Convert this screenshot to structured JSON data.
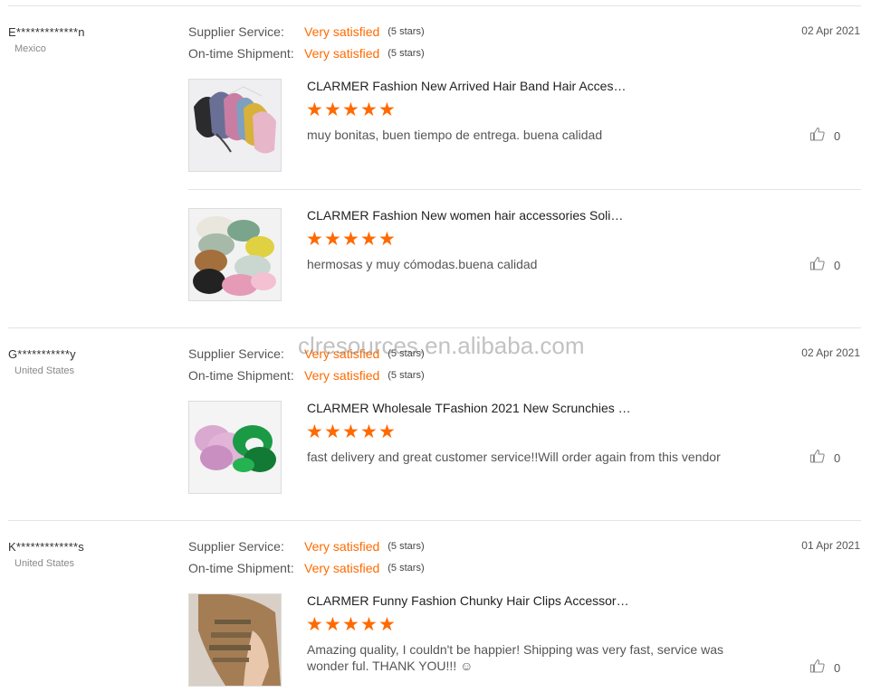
{
  "reviews": [
    {
      "name": "E*************n",
      "country": "Mexico",
      "date": "02 Apr 2021",
      "supplier_label": "Supplier Service:",
      "supplier_value": "Very satisfied",
      "supplier_stars": "(5 stars)",
      "shipment_label": "On-time Shipment:",
      "shipment_value": "Very satisfied",
      "shipment_stars": "(5 stars)",
      "products": [
        {
          "title": "CLARMER Fashion New Arrived Hair Band Hair Acces…",
          "rating": 5,
          "comment": "muy bonitas, buen tiempo de entrega. buena calidad",
          "likes": "0"
        },
        {
          "title": "CLARMER Fashion New women hair accessories Soli…",
          "rating": 5,
          "comment": "hermosas y muy cómodas.buena calidad",
          "likes": "0"
        }
      ]
    },
    {
      "name": "G***********y",
      "country": "United States",
      "date": "02 Apr 2021",
      "supplier_label": "Supplier Service:",
      "supplier_value": "Very satisfied",
      "supplier_stars": "(5 stars)",
      "shipment_label": "On-time Shipment:",
      "shipment_value": "Very satisfied",
      "shipment_stars": "(5 stars)",
      "products": [
        {
          "title": "CLARMER Wholesale TFashion 2021 New Scrunchies …",
          "rating": 5,
          "comment": "fast delivery and great customer service!!Will order again from this vendor",
          "likes": "0"
        }
      ]
    },
    {
      "name": "K*************s",
      "country": "United States",
      "date": "01 Apr 2021",
      "supplier_label": "Supplier Service:",
      "supplier_value": "Very satisfied",
      "supplier_stars": "(5 stars)",
      "shipment_label": "On-time Shipment:",
      "shipment_value": "Very satisfied",
      "shipment_stars": "(5 stars)",
      "products": [
        {
          "title": "CLARMER Funny Fashion Chunky Hair Clips Accessor…",
          "rating": 5,
          "comment": "Amazing quality, I couldn't be happier! Shipping was very fast, service was wonder ful. THANK YOU!!! ☺",
          "likes": "0"
        }
      ]
    }
  ],
  "watermark": "clresources.en.alibaba.com",
  "colors": {
    "accent": "#ff6a00",
    "divider": "#e3e3e3"
  },
  "icons": {
    "like": "thumbs-up-icon",
    "star": "star-icon"
  }
}
